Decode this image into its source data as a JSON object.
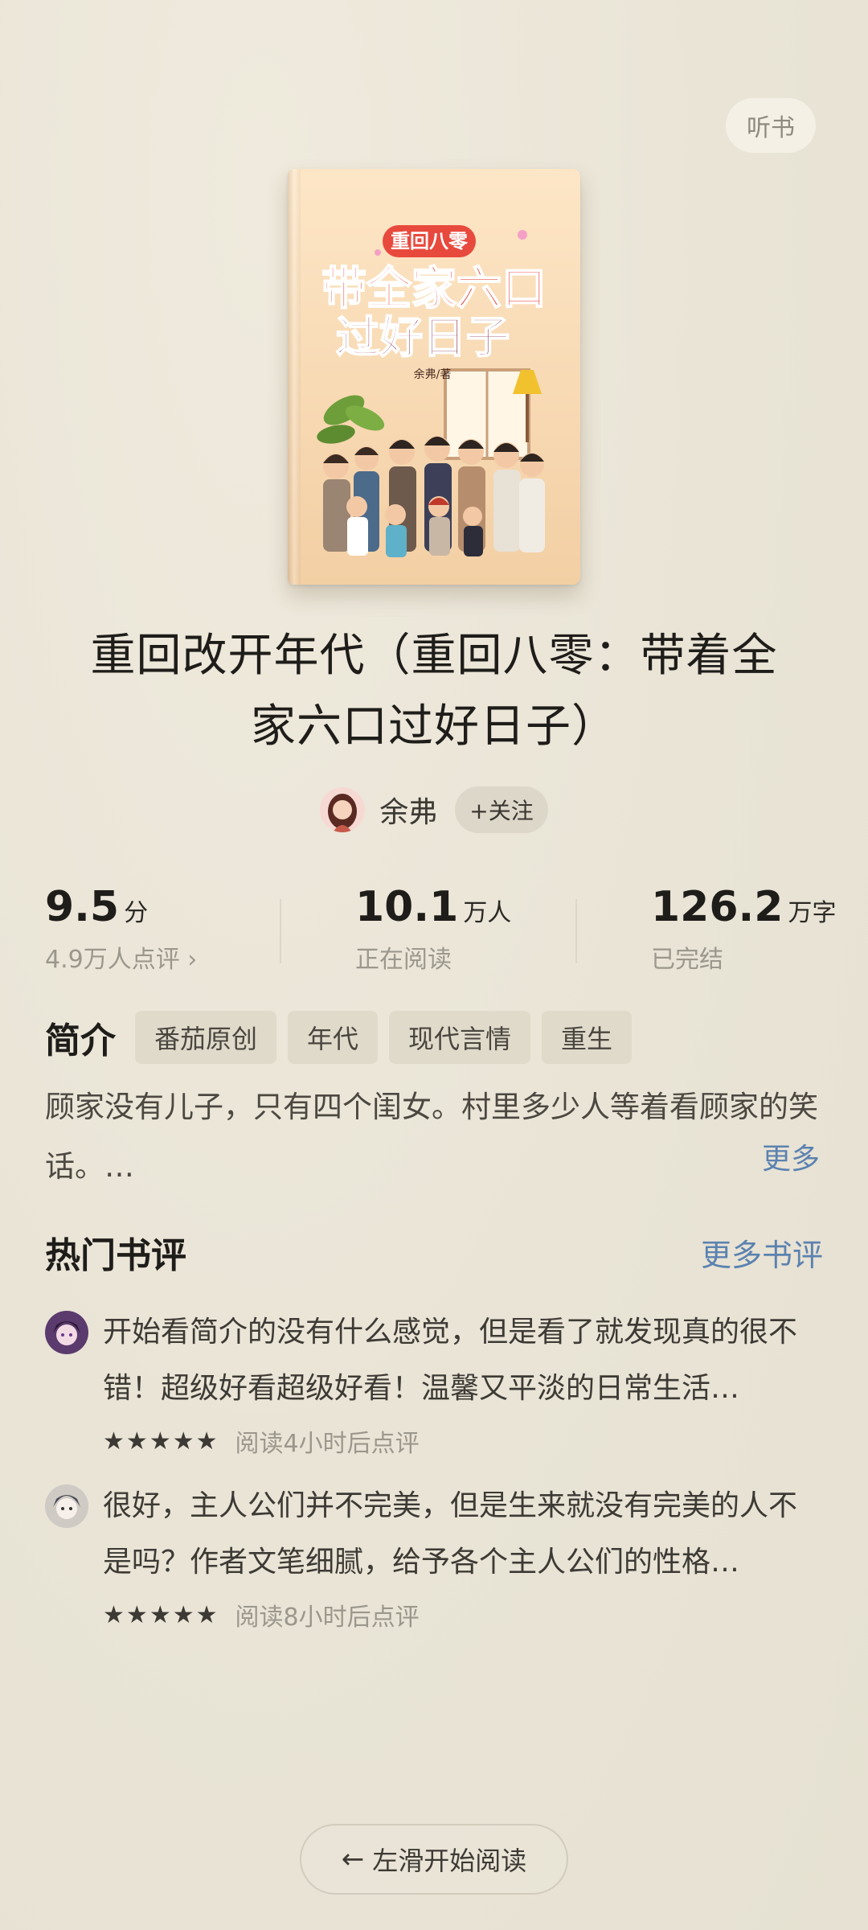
{
  "header": {
    "listen_label": "听书"
  },
  "cover": {
    "series": "重回八零",
    "title_line1": "带全家六口",
    "title_line2": "过好日子",
    "author_mark": "余弗/著"
  },
  "book": {
    "title": "重回改开年代（重回八零：带着全家六口过好日子）",
    "author": "余弗",
    "follow_label": "+关注"
  },
  "stats": {
    "rating": {
      "value": "9.5",
      "unit": "分",
      "sub": "4.9万人点评 ›"
    },
    "readers": {
      "value": "10.1",
      "unit": "万人",
      "sub": "正在阅读"
    },
    "words": {
      "value": "126.2",
      "unit": "万字",
      "sub": "已完结"
    }
  },
  "intro": {
    "title": "简介",
    "tags": [
      "番茄原创",
      "年代",
      "现代言情",
      "重生"
    ],
    "synopsis": "顾家没有儿子，只有四个闺女。村里多少人等着看顾家的笑话。…",
    "more_label": "更多"
  },
  "reviews": {
    "title": "热门书评",
    "more_label": "更多书评",
    "items": [
      {
        "text": "开始看简介的没有什么感觉，但是看了就发现真的很不错！超级好看超级好看！温馨又平淡的日常生活…",
        "stars": 5,
        "meta": "阅读4小时后点评"
      },
      {
        "text": "很好，主人公们并不完美，但是生来就没有完美的人不是吗？作者文笔细腻，给予各个主人公们的性格…",
        "stars": 5,
        "meta": "阅读8小时后点评"
      }
    ]
  },
  "footer": {
    "read_label": "左滑开始阅读"
  },
  "colors": {
    "background": "#e9e4d6",
    "link": "#5b82b0",
    "cover_title": "#e8493d"
  }
}
